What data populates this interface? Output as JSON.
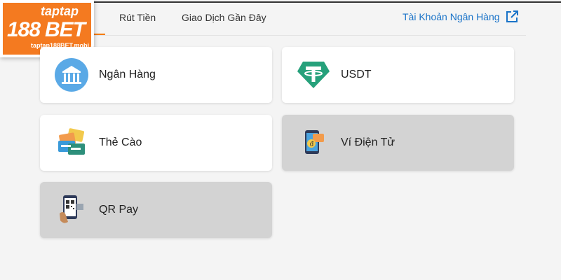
{
  "brand": {
    "taptap": "taptap",
    "num": "188",
    "bet": "BET",
    "url": "taptap188BET.mobi"
  },
  "nav": {
    "tabs": [
      {
        "label": "Rút Tiền"
      },
      {
        "label": "Giao Dịch Gần Đây"
      }
    ],
    "bank_account_link": "Tài Khoản Ngân Hàng"
  },
  "methods": [
    {
      "label": "Ngân Hàng",
      "icon": "bank-icon",
      "enabled": true
    },
    {
      "label": "USDT",
      "icon": "tether-icon",
      "enabled": true
    },
    {
      "label": "Thẻ Cào",
      "icon": "scratch-card-icon",
      "enabled": true
    },
    {
      "label": "Ví Điện Tử",
      "icon": "e-wallet-icon",
      "enabled": false
    },
    {
      "label": "QR Pay",
      "icon": "qr-phone-icon",
      "enabled": false
    }
  ],
  "colors": {
    "accent": "#f57c00",
    "link": "#1a73c8",
    "tether": "#26a17b",
    "bank_circle": "#5aa9e6"
  }
}
